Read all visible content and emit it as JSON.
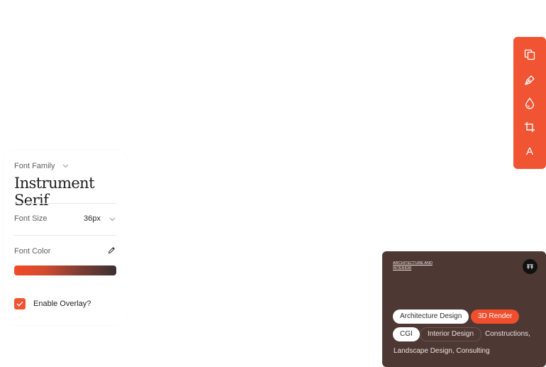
{
  "settings": {
    "font_family_label": "Font Family",
    "font_family_value": "Instrument Serif",
    "font_size_label": "Font Size",
    "font_size_value": "36px",
    "font_color_label": "Font Color",
    "gradient_colors": [
      "#f24a25",
      "#d24a30",
      "#7a3d34",
      "#3b3032"
    ],
    "overlay_label": "Enable Overlay?",
    "overlay_checked": true
  },
  "toolbar": {
    "accent": "#f05433",
    "tools": [
      {
        "icon": "copy-icon"
      },
      {
        "icon": "pen-tool-icon"
      },
      {
        "icon": "drop-icon"
      },
      {
        "icon": "crop-icon"
      },
      {
        "icon": "text-icon",
        "glyph": "A"
      }
    ]
  },
  "preview": {
    "background": "#4d3834",
    "eyebrow": "ARCHITECTURE AND INTERIOR",
    "badge_icon": "logo-badge-icon",
    "tags": [
      "Architecture Design",
      "3D Render",
      "CGI",
      "Interior Design",
      "Constructions,",
      "Landscape Design, Consulting"
    ]
  }
}
